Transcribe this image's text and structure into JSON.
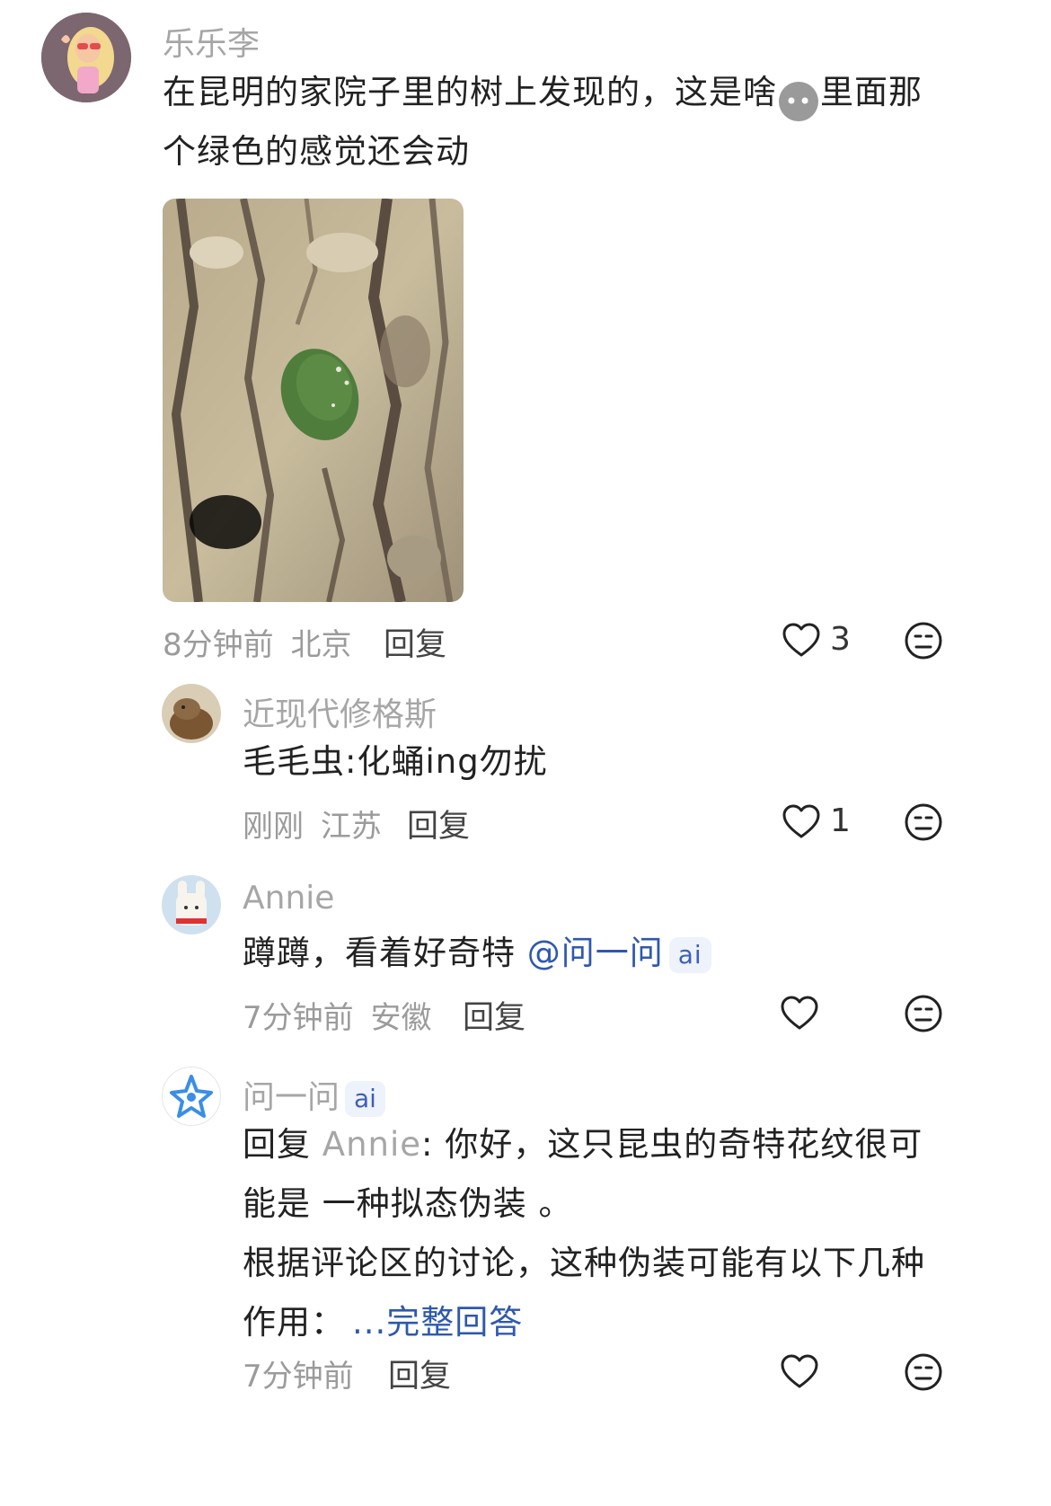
{
  "comments": [
    {
      "username": "乐乐李",
      "text_line1": "在昆明的家院子里的树上发现的，这是啥",
      "text_emoji": "😶",
      "text_line1_end": "里面那",
      "text_line2": "个绿色的感觉还会动",
      "time": "8分钟前",
      "location": "北京",
      "reply_label": "回复",
      "like_count": "3"
    },
    {
      "username": "近现代修格斯",
      "text": "毛毛虫:化蛹ing勿扰",
      "time": "刚刚",
      "location": "江苏",
      "reply_label": "回复",
      "like_count": "1"
    },
    {
      "username": "Annie",
      "text": "蹲蹲，看着好奇特",
      "mention": "@问一问",
      "mention_badge": "ai",
      "time": "7分钟前",
      "location": "安徽",
      "reply_label": "回复",
      "like_count": ""
    },
    {
      "username": "问一问",
      "user_badge": "ai",
      "reply_prefix": "回复",
      "reply_to": "Annie",
      "text_line1": ": 你好，这只昆虫的奇特花纹很可",
      "text_line2": "能是 一种拟态伪装 。",
      "text_line3": "根据评论区的讨论，这种伪装可能有以下几种",
      "text_line4": "作用：",
      "more_link": "...完整回答",
      "time": "7分钟前",
      "reply_label": "回复",
      "like_count": ""
    }
  ],
  "colors": {
    "accent_link": "#2e59ad",
    "meta_gray": "#9b9b9b",
    "ai_badge_bg": "#eef2fb"
  },
  "icons": [
    "heart-outline-icon",
    "dislike-face-icon",
    "ai-star-icon",
    "emoji-face-icon"
  ]
}
